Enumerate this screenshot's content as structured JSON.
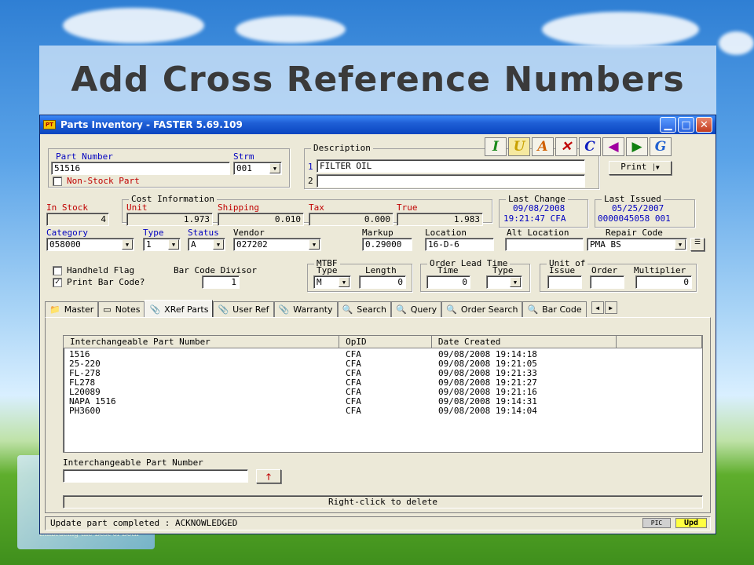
{
  "slide": {
    "title": "Add Cross Reference Numbers",
    "side_caption": "Embracing the Best of Both"
  },
  "window": {
    "title": "Parts Inventory - FASTER 5.69.109",
    "app_icon_text": "PT"
  },
  "toolbar": {
    "icons": [
      {
        "letter": "I",
        "color": "#1a8a1a",
        "name": "insert"
      },
      {
        "letter": "U",
        "color": "#c8a000",
        "name": "update"
      },
      {
        "letter": "A",
        "color": "#d06000",
        "name": "add"
      },
      {
        "letter": "✕",
        "color": "#c00000",
        "name": "delete"
      },
      {
        "letter": "C",
        "color": "#1020c0",
        "name": "clear"
      },
      {
        "letter": "◀",
        "color": "#a000a0",
        "name": "previous"
      },
      {
        "letter": "▶",
        "color": "#108010",
        "name": "next"
      },
      {
        "letter": "G",
        "color": "#2060d0",
        "name": "go"
      }
    ],
    "print_label": "Print"
  },
  "part": {
    "part_number_label": "Part Number",
    "part_number": "51516",
    "strm_label": "Strm",
    "strm": "001",
    "non_stock_label": "Non-Stock Part"
  },
  "description": {
    "label": "Description",
    "line1_no": "1",
    "line1": "FILTER OIL",
    "line2_no": "2",
    "line2": ""
  },
  "cost": {
    "group_label": "Cost Information",
    "in_stock_label": "In Stock",
    "in_stock": "4",
    "unit_label": "Unit",
    "unit": "1.973",
    "shipping_label": "Shipping",
    "shipping": "0.010",
    "tax_label": "Tax",
    "tax": "0.000",
    "true_label": "True",
    "true": "1.983"
  },
  "last_change": {
    "label": "Last Change",
    "date": "09/08/2008",
    "time": "19:21:47 CFA"
  },
  "last_issued": {
    "label": "Last Issued",
    "date": "05/25/2007",
    "ref": "0000045058 001"
  },
  "classification": {
    "category_label": "Category",
    "category": "058000",
    "type_label": "Type",
    "type": "1",
    "status_label": "Status",
    "status": "A",
    "vendor_label": "Vendor",
    "vendor": "027202",
    "markup_label": "Markup",
    "markup": "0.29000",
    "location_label": "Location",
    "location": "16-D-6",
    "alt_location_label": "Alt Location",
    "alt_location": "",
    "repair_code_label": "Repair Code",
    "repair_code": "PMA BS"
  },
  "flags": {
    "handheld_label": "Handheld Flag",
    "print_bar_label": "Print Bar Code?",
    "bar_code_divisor_label": "Bar Code Divisor",
    "bar_code_divisor": "1"
  },
  "mtbf": {
    "label": "MTBF",
    "type_label": "Type",
    "type": "M",
    "length_label": "Length",
    "length": "0"
  },
  "order_lead": {
    "label": "Order Lead Time",
    "time_label": "Time",
    "time": "0",
    "type_label": "Type",
    "type": ""
  },
  "unit_of": {
    "label": "Unit of",
    "issue_label": "Issue",
    "issue": "",
    "order_label": "Order",
    "order": "",
    "multiplier_label": "Multiplier",
    "multiplier": "0"
  },
  "tabs": [
    {
      "label": "Master",
      "icon": "folder"
    },
    {
      "label": "Notes",
      "icon": "note"
    },
    {
      "label": "XRef Parts",
      "icon": "clip",
      "active": true
    },
    {
      "label": "User Ref",
      "icon": "clip"
    },
    {
      "label": "Warranty",
      "icon": "clip"
    },
    {
      "label": "Search",
      "icon": "magnifier"
    },
    {
      "label": "Query",
      "icon": "magnifier"
    },
    {
      "label": "Order Search",
      "icon": "magnifier"
    },
    {
      "label": "Bar Code",
      "icon": "magnifier"
    }
  ],
  "xref": {
    "columns": [
      "Interchangeable Part Number",
      "OpID",
      "Date Created",
      ""
    ],
    "rows": [
      [
        "1516",
        "CFA",
        "09/08/2008 19:14:18"
      ],
      [
        "25-220",
        "CFA",
        "09/08/2008 19:21:05"
      ],
      [
        "FL-278",
        "CFA",
        "09/08/2008 19:21:33"
      ],
      [
        "FL278",
        "CFA",
        "09/08/2008 19:21:27"
      ],
      [
        "L20089",
        "CFA",
        "09/08/2008 19:21:16"
      ],
      [
        "NAPA 1516",
        "CFA",
        "09/08/2008 19:14:31"
      ],
      [
        "PH3600",
        "CFA",
        "09/08/2008 19:14:04"
      ]
    ],
    "entry_label": "Interchangeable Part Number",
    "entry_value": "",
    "hint": "Right-click to delete"
  },
  "status_bar": {
    "message": "Update part completed : ACKNOWLEDGED",
    "pic": "PIC",
    "upd": "Upd"
  }
}
